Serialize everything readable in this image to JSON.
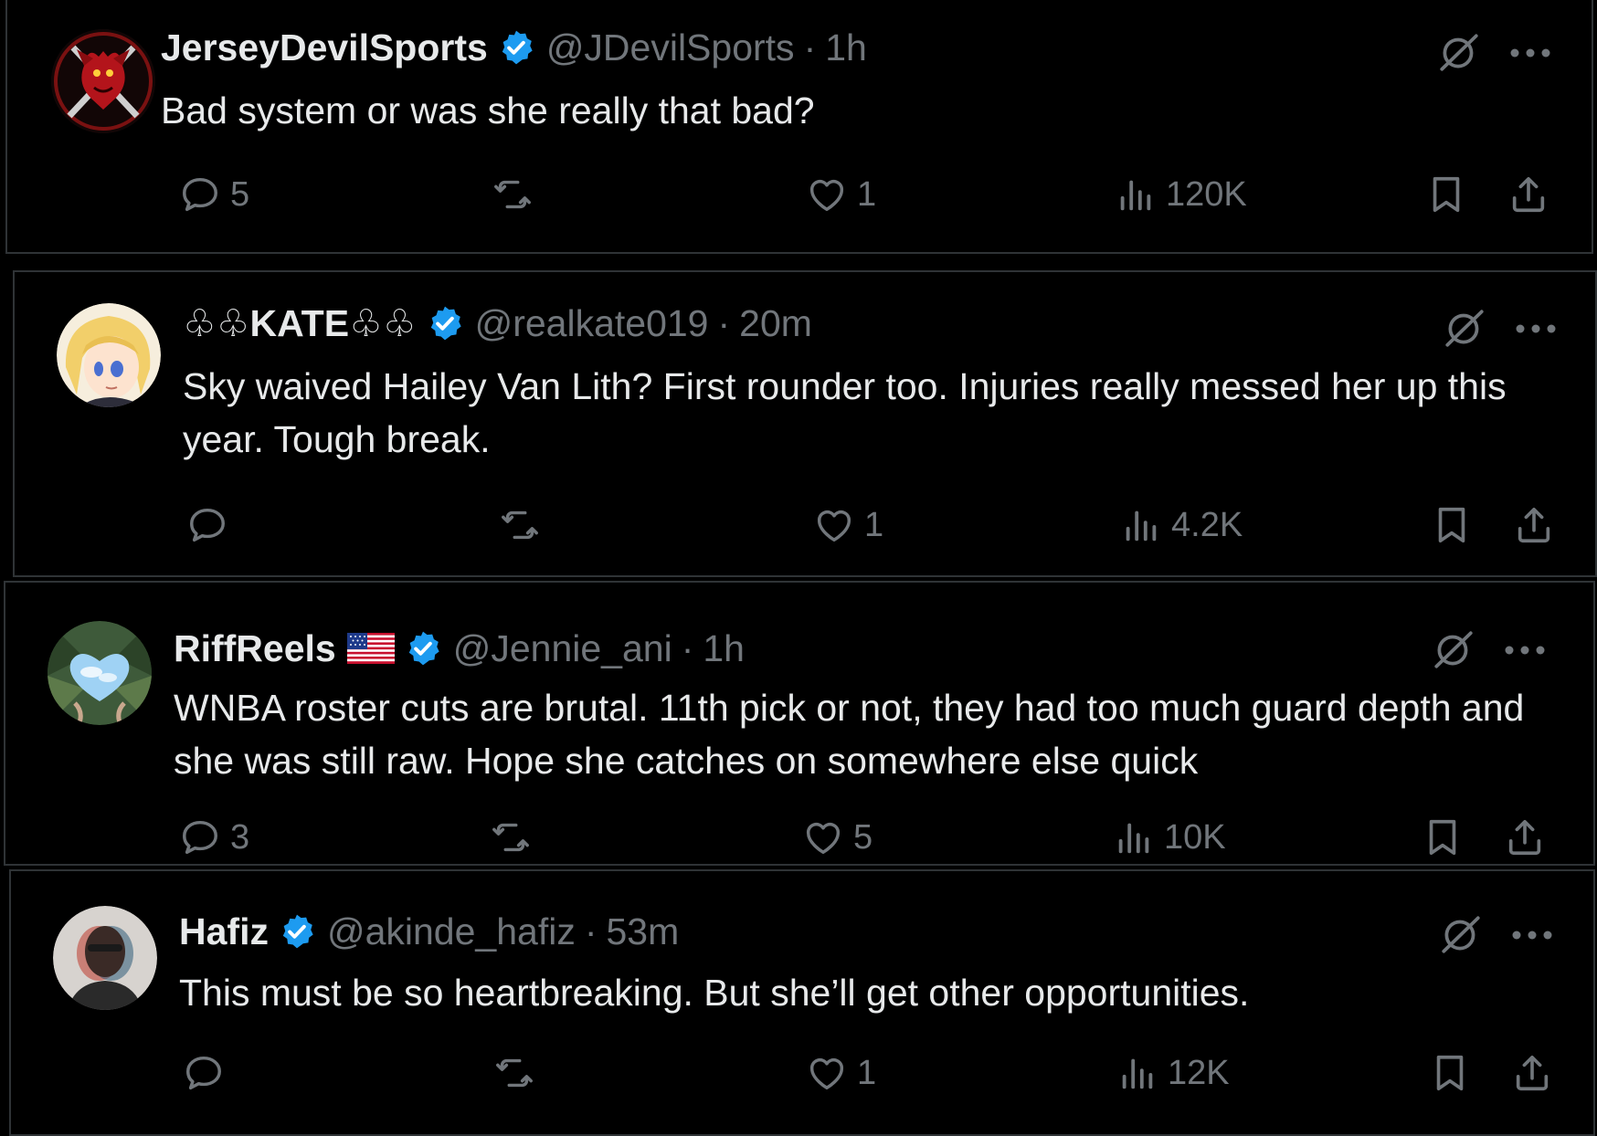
{
  "colors": {
    "background": "#000000",
    "text_primary": "#e7e9ea",
    "text_secondary": "#71767b",
    "verified_blue": "#1d9bf0",
    "divider": "#2f3336"
  },
  "tweets": [
    {
      "display_name": "JerseyDevilSports",
      "handle": "@JDevilSports",
      "separator": "·",
      "time": "1h",
      "text": "Bad system or was she really that bad?",
      "verified": true,
      "flag": false,
      "avatar_icon": "devil-logo-avatar",
      "replies": "5",
      "reposts": "",
      "likes": "1",
      "views": "120K"
    },
    {
      "display_name": "♧♧KATE♧♧",
      "handle": "@realkate019",
      "separator": "·",
      "time": "20m",
      "text": "Sky waived Hailey Van Lith? First rounder too. Injuries really messed her up this year. Tough break.",
      "verified": true,
      "flag": false,
      "avatar_icon": "anime-girl-avatar",
      "replies": "",
      "reposts": "",
      "likes": "1",
      "views": "4.2K"
    },
    {
      "display_name": "RiffReels",
      "handle": "@Jennie_ani",
      "separator": "·",
      "time": "1h",
      "text": "WNBA roster cuts are brutal. 11th pick or not, they had too much guard depth and she was still raw. Hope she catches on somewhere else quick",
      "verified": true,
      "flag": true,
      "avatar_icon": "heart-sky-avatar",
      "replies": "3",
      "reposts": "",
      "likes": "5",
      "views": "10K"
    },
    {
      "display_name": "Hafiz",
      "handle": "@akinde_hafiz",
      "separator": "·",
      "time": "53m",
      "text": "This must be so heartbreaking. But she’ll get other opportunities.",
      "verified": true,
      "flag": false,
      "avatar_icon": "portrait-avatar",
      "replies": "",
      "reposts": "",
      "likes": "1",
      "views": "12K"
    }
  ],
  "icons": {
    "reply": "reply-icon",
    "repost": "repost-icon",
    "like": "like-icon",
    "views": "views-icon",
    "bookmark": "bookmark-icon",
    "share": "share-icon",
    "grok": "grok-icon",
    "more": "more-icon",
    "verified": "verified-icon",
    "flag": "us-flag-icon"
  }
}
